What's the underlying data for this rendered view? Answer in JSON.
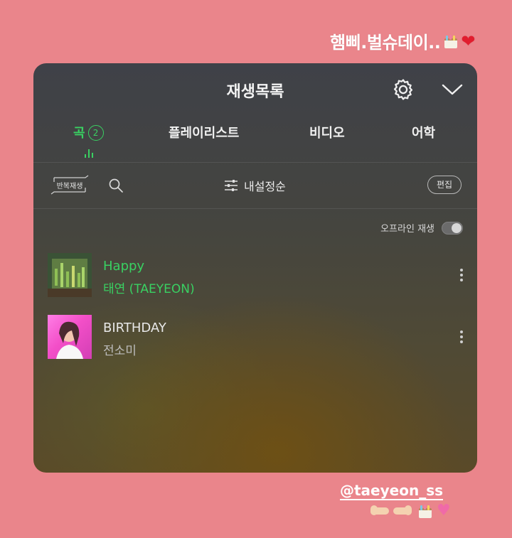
{
  "story": {
    "caption": "햄삐.벌슈데이..",
    "mention": "@taeyeon_ss"
  },
  "player": {
    "title": "재생목록",
    "tabs": [
      {
        "label": "곡",
        "badge": "2",
        "active": true
      },
      {
        "label": "플레이리스트"
      },
      {
        "label": "비디오"
      },
      {
        "label": "어학"
      }
    ],
    "toolbar": {
      "repeat_label": "반복재생",
      "sort_label": "내설정순",
      "edit_label": "편집"
    },
    "offline": {
      "label": "오프라인 재생",
      "enabled": false
    },
    "songs": [
      {
        "title": "Happy",
        "artist": "태연 (TAEYEON)",
        "playing": true
      },
      {
        "title": "BIRTHDAY",
        "artist": "전소미",
        "playing": false
      }
    ]
  },
  "colors": {
    "background": "#ea858b",
    "accent": "#39d162"
  },
  "icons": [
    "cake-emoji",
    "heart-emoji",
    "gear-icon",
    "chevron-down-icon",
    "search-icon",
    "sort-icon",
    "more-icon",
    "equalizer-icon",
    "repeat-icon"
  ]
}
